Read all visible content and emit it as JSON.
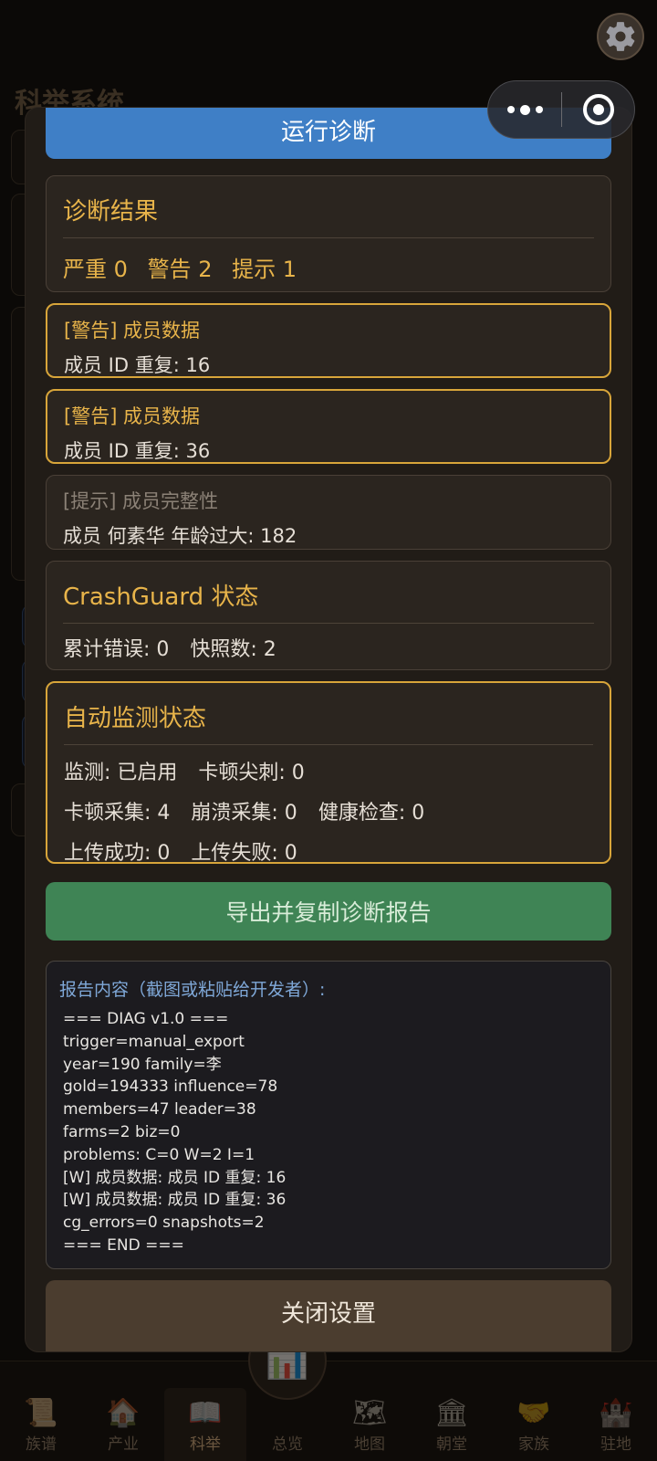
{
  "background": {
    "title": "科举系统"
  },
  "modal": {
    "run_button": "运行诊断",
    "diag_result": {
      "title": "诊断结果",
      "severe_label": "严重",
      "severe_count": "0",
      "warning_label": "警告",
      "warning_count": "2",
      "hint_label": "提示",
      "hint_count": "1"
    },
    "issues": [
      {
        "tag": "[警告] 成员数据",
        "detail": "成员 ID 重复: 16"
      },
      {
        "tag": "[警告] 成员数据",
        "detail": "成员 ID 重复: 36"
      },
      {
        "tag": "[提示] 成员完整性",
        "detail": "成员 何素华 年龄过大: 182"
      }
    ],
    "crashguard": {
      "title": "CrashGuard 状态",
      "errors": "累计错误: 0",
      "snapshots": "快照数: 2"
    },
    "monitor": {
      "title": "自动监测状态",
      "monitoring": "监测: 已启用",
      "stall_spike": "卡顿尖刺: 0",
      "stall_collect": "卡顿采集: 4",
      "crash_collect": "崩溃采集: 0",
      "health_check": "健康检查: 0",
      "upload_ok": "上传成功: 0",
      "upload_fail": "上传失败: 0"
    },
    "export_button": "导出并复制诊断报告",
    "report": {
      "label": "报告内容（截图或粘贴给开发者）:",
      "lines": [
        "=== DIAG v1.0 ===",
        "trigger=manual_export",
        "year=190 family=李",
        "gold=194333 influence=78",
        "members=47 leader=38",
        "farms=2 biz=0",
        "problems: C=0 W=2 I=1",
        "[W] 成员数据: 成员 ID 重复: 16",
        "[W] 成员数据: 成员 ID 重复: 36",
        "cg_errors=0 snapshots=2",
        "=== END ==="
      ]
    },
    "close_button": "关闭设置"
  },
  "nav": [
    {
      "label": "族谱",
      "icon": "scroll-icon",
      "glyph": "📜"
    },
    {
      "label": "产业",
      "icon": "house-icon",
      "glyph": "🏠"
    },
    {
      "label": "科举",
      "icon": "book-icon",
      "glyph": "📖"
    },
    {
      "label": "总览",
      "icon": "chart-icon",
      "glyph": "📊"
    },
    {
      "label": "地图",
      "icon": "map-icon",
      "glyph": "🗺"
    },
    {
      "label": "朝堂",
      "icon": "court-icon",
      "glyph": "🏛"
    },
    {
      "label": "家族",
      "icon": "handshake-icon",
      "glyph": "🤝"
    },
    {
      "label": "驻地",
      "icon": "castle-icon",
      "glyph": "🏰"
    }
  ],
  "nav_active": "科举",
  "colors": {
    "accent_gold": "#e8b44a",
    "run_blue": "#3f7fc6",
    "export_green": "#3f8455",
    "close_brown": "#4b3d2f"
  }
}
